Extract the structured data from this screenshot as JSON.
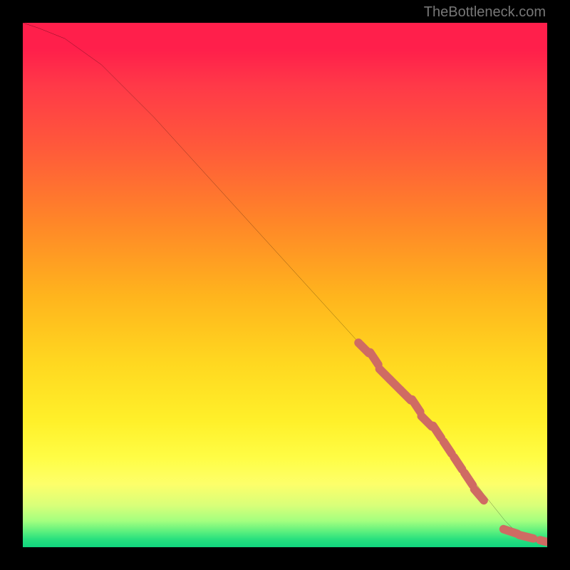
{
  "watermark": "TheBottleneck.com",
  "chart_data": {
    "type": "line",
    "title": "",
    "xlabel": "",
    "ylabel": "",
    "xlim": [
      0,
      100
    ],
    "ylim": [
      0,
      100
    ],
    "grid": false,
    "legend": false,
    "series": [
      {
        "name": "bottleneck-curve",
        "x": [
          0,
          3,
          8,
          15,
          25,
          35,
          45,
          55,
          65,
          75,
          82,
          88,
          92,
          95,
          98,
          100
        ],
        "y": [
          100,
          99,
          97,
          92,
          82,
          71,
          60,
          49,
          38,
          27,
          18,
          10,
          5,
          2,
          1,
          1
        ]
      }
    ],
    "markers": {
      "name": "highlighted-range",
      "color": "#cf6b63",
      "points": [
        {
          "x": 65,
          "y": 38
        },
        {
          "x": 67,
          "y": 36
        },
        {
          "x": 69,
          "y": 33
        },
        {
          "x": 71,
          "y": 31
        },
        {
          "x": 73,
          "y": 29
        },
        {
          "x": 75,
          "y": 27
        },
        {
          "x": 77,
          "y": 24
        },
        {
          "x": 79,
          "y": 22
        },
        {
          "x": 81,
          "y": 19
        },
        {
          "x": 83,
          "y": 16
        },
        {
          "x": 85,
          "y": 13
        },
        {
          "x": 87,
          "y": 10
        },
        {
          "x": 93,
          "y": 3
        },
        {
          "x": 96,
          "y": 2
        },
        {
          "x": 100,
          "y": 1
        }
      ]
    },
    "gradient_stops": [
      {
        "pos": 0.0,
        "color": "#ff1f4b"
      },
      {
        "pos": 0.5,
        "color": "#ffc020"
      },
      {
        "pos": 0.85,
        "color": "#ffff50"
      },
      {
        "pos": 1.0,
        "color": "#10d57e"
      }
    ]
  }
}
